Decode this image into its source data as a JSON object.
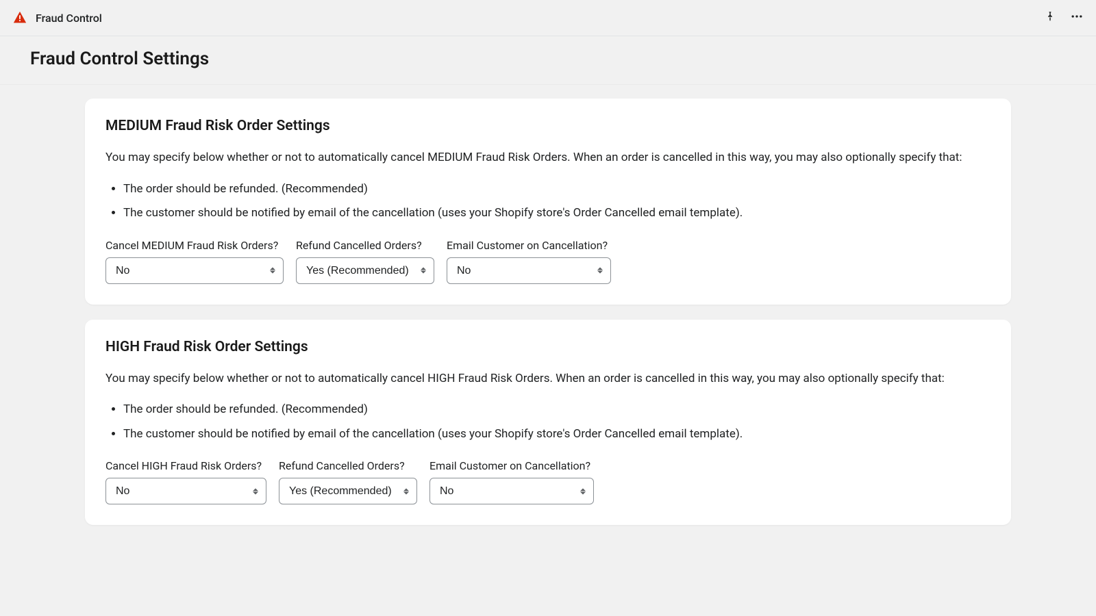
{
  "header": {
    "app_name": "Fraud Control"
  },
  "page": {
    "title": "Fraud Control Settings"
  },
  "sections": {
    "medium": {
      "title": "MEDIUM Fraud Risk Order Settings",
      "description": "You may specify below whether or not to automatically cancel MEDIUM Fraud Risk Orders. When an order is cancelled in this way, you may also optionally specify that:",
      "bullets": {
        "refund": "The order should be refunded. (Recommended)",
        "email": "The customer should be notified by email of the cancellation (uses your Shopify store's Order Cancelled email template)."
      },
      "fields": {
        "cancel": {
          "label": "Cancel MEDIUM Fraud Risk Orders?",
          "value": "No"
        },
        "refund": {
          "label": "Refund Cancelled Orders?",
          "value": "Yes (Recommended)"
        },
        "email": {
          "label": "Email Customer on Cancellation?",
          "value": "No"
        }
      }
    },
    "high": {
      "title": "HIGH Fraud Risk Order Settings",
      "description": "You may specify below whether or not to automatically cancel HIGH Fraud Risk Orders. When an order is cancelled in this way, you may also optionally specify that:",
      "bullets": {
        "refund": "The order should be refunded. (Recommended)",
        "email": "The customer should be notified by email of the cancellation (uses your Shopify store's Order Cancelled email template)."
      },
      "fields": {
        "cancel": {
          "label": "Cancel HIGH Fraud Risk Orders?",
          "value": "No"
        },
        "refund": {
          "label": "Refund Cancelled Orders?",
          "value": "Yes (Recommended)"
        },
        "email": {
          "label": "Email Customer on Cancellation?",
          "value": "No"
        }
      }
    }
  }
}
